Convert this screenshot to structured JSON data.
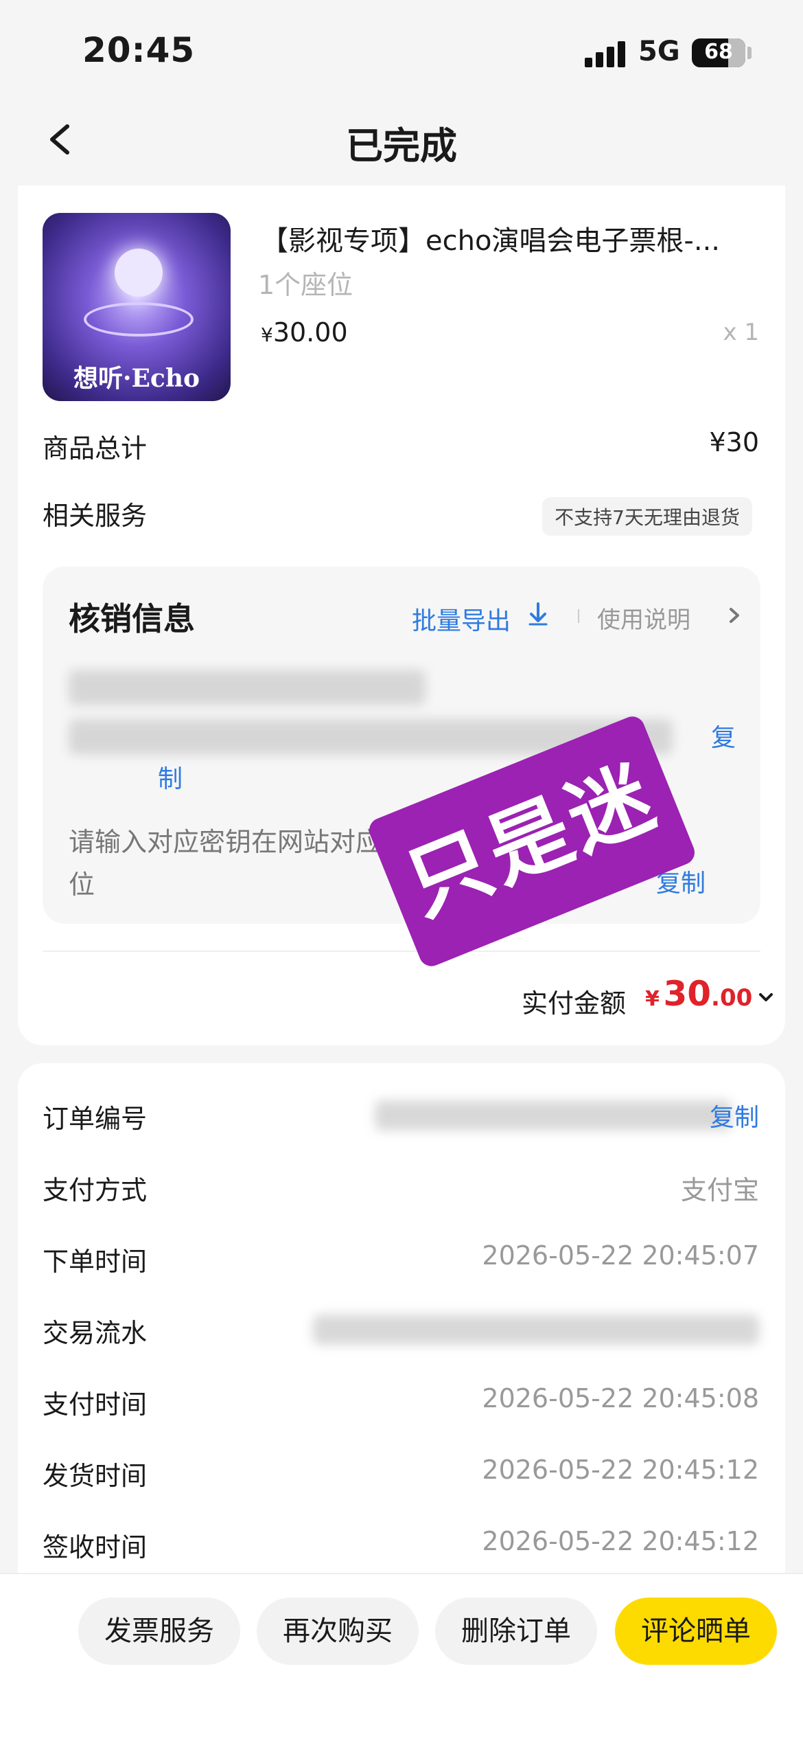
{
  "status_bar": {
    "time": "20:45",
    "network": "5G",
    "battery": "68"
  },
  "nav": {
    "title": "已完成"
  },
  "product": {
    "title": "【影视专项】echo演唱会电子票根-...",
    "subtitle": "1个座位",
    "price_symbol": "¥",
    "price": "30.00",
    "quantity": "x 1",
    "image_text": "想听·Echo"
  },
  "summary": {
    "total_label": "商品总计",
    "total_value": "¥30",
    "service_label": "相关服务",
    "service_badge": "不支持7天无理由退货"
  },
  "verify": {
    "title": "核销信息",
    "export_label": "批量导出",
    "usage_label": "使用说明",
    "copy_label_1a": "复",
    "copy_label_1b": "制",
    "hint": "请输入对应密钥在网站对应位置，即可认领自己的座位",
    "copy_label_2": "复制"
  },
  "stamp": {
    "text": "只是迷"
  },
  "payment": {
    "label": "实付金额",
    "symbol": "¥",
    "integer": "30",
    "decimal": ".00"
  },
  "order_info": {
    "order_no_label": "订单编号",
    "order_no_copy": "复制",
    "pay_method_label": "支付方式",
    "pay_method_value": "支付宝",
    "order_time_label": "下单时间",
    "order_time_value": "2026-05-22 20:45:07",
    "txn_label": "交易流水",
    "pay_time_label": "支付时间",
    "pay_time_value": "2026-05-22 20:45:08",
    "ship_time_label": "发货时间",
    "ship_time_value": "2026-05-22 20:45:12",
    "receive_time_label": "签收时间",
    "receive_time_value": "2026-05-22 20:45:12"
  },
  "actions": {
    "invoice": "发票服务",
    "rebuy": "再次购买",
    "delete": "删除订单",
    "review": "评论晒单"
  },
  "colors": {
    "accent_yellow": "#fedb00",
    "price_red": "#e0222b",
    "link_blue": "#2f7be0",
    "stamp_purple": "#9b22b2"
  }
}
